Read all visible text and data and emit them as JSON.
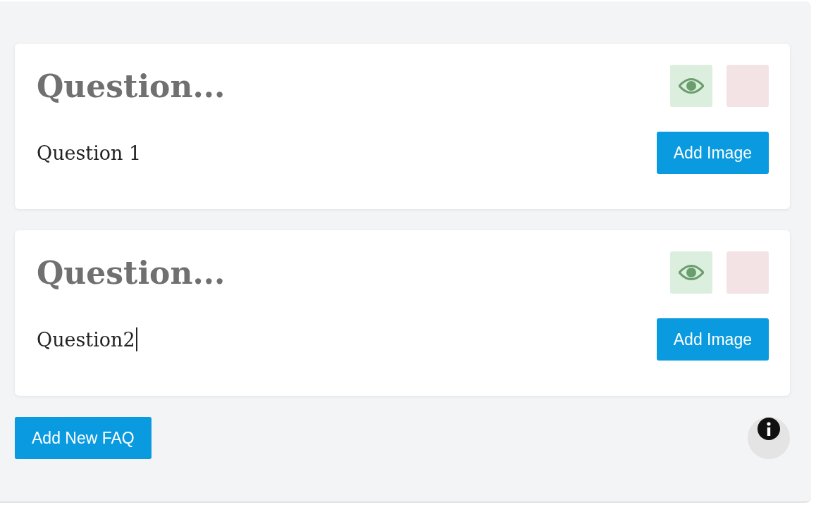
{
  "faqs": [
    {
      "title_placeholder": "Question...",
      "answer": "Question 1",
      "focused": false,
      "add_image": "Add Image"
    },
    {
      "title_placeholder": "Question...",
      "answer": "Question2",
      "focused": true,
      "add_image": "Add Image"
    }
  ],
  "add_button": "Add New FAQ"
}
